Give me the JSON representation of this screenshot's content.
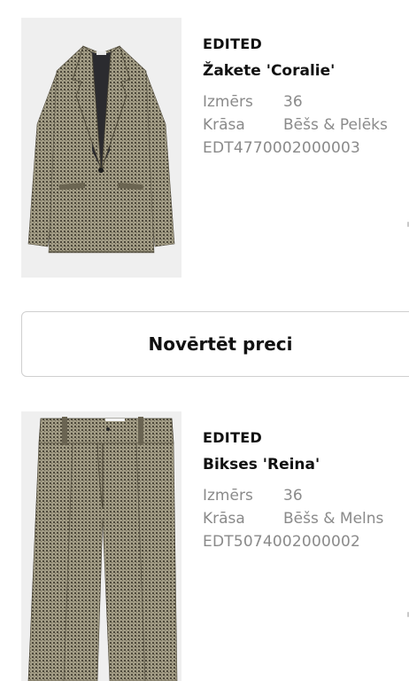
{
  "products": [
    {
      "brand": "EDITED",
      "name": "Žakete 'Coralie'",
      "size_label": "Izmērs",
      "size_value": "36",
      "color_label": "Krāsa",
      "color_value": "Bēšs & Pelēks",
      "sku": "EDT4770002000003",
      "image": "blazer-houndstooth"
    },
    {
      "brand": "EDITED",
      "name": "Bikses 'Reina'",
      "size_label": "Izmērs",
      "size_value": "36",
      "color_label": "Krāsa",
      "color_value": "Bēšs & Melns",
      "sku": "EDT5074002000002",
      "image": "trousers-houndstooth"
    }
  ],
  "rate_button": {
    "label": "Novērtēt preci"
  },
  "colors": {
    "fabric": "#8c8670",
    "fabric_dark": "#5a5546",
    "image_bg": "#efefef",
    "muted_text": "#8a8a8a",
    "border": "#cfcfcf"
  }
}
